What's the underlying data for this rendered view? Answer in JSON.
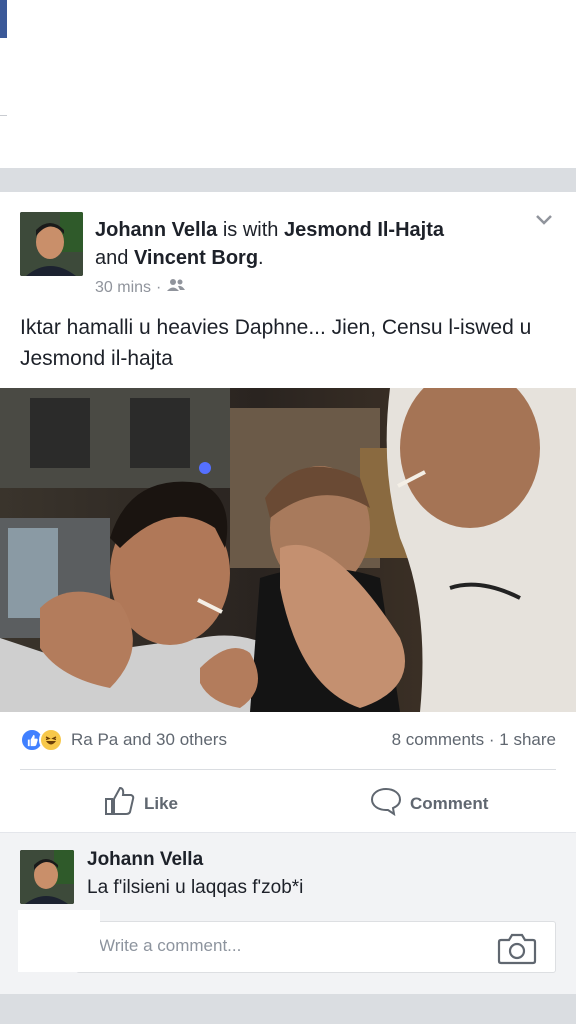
{
  "post": {
    "author": "Johann Vella",
    "with_text": " is with ",
    "tagged_1": "Jesmond Il-Hajta",
    "and_text": " and ",
    "tagged_2": "Vincent Borg",
    "period": ".",
    "time": "30 mins",
    "dot": "·",
    "audience_icon": "friends-icon",
    "text": "Iktar hamalli u heavies Daphne... Jien, Censu l-iswed u Jesmond il-hajta"
  },
  "reactions": {
    "icons": [
      "like-reaction-icon",
      "haha-reaction-icon"
    ],
    "summary": "Ra Pa and 30 others",
    "comments": "8 comments",
    "sep": "·",
    "shares": "1 share"
  },
  "actions": {
    "like_label": "Like",
    "comment_label": "Comment"
  },
  "comment": {
    "author": "Johann Vella",
    "text": "La f'ilsieni u laqqas f'zob*i"
  },
  "composer": {
    "placeholder": "Write a comment..."
  },
  "colors": {
    "brand": "#3b5998",
    "like_blue": "#4080ff",
    "text_muted": "#606770",
    "separator": "#dadde1"
  }
}
